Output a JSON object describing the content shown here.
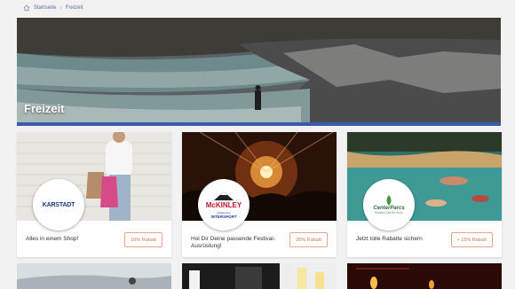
{
  "breadcrumb": {
    "home": "Startseite",
    "current": "Freizeit"
  },
  "hero": {
    "title": "Freizeit"
  },
  "cards": [
    {
      "logo": "KARSTADT",
      "description": "Alles in einem Shop!",
      "button": "10% Rabatt"
    },
    {
      "logo": "McKINLEY",
      "logo_sub": "powered by",
      "logo_sub2": "INTERSPORT",
      "description": "Hol Dir Deine passende Festival-Ausrüstung!",
      "button": "20% Rabatt"
    },
    {
      "logo": "CenterParcs",
      "logo_sub": "Endlich Zeit für euch",
      "description": "Jetzt tolle Rabatte sichern",
      "button": "> 15% Rabatt"
    }
  ]
}
